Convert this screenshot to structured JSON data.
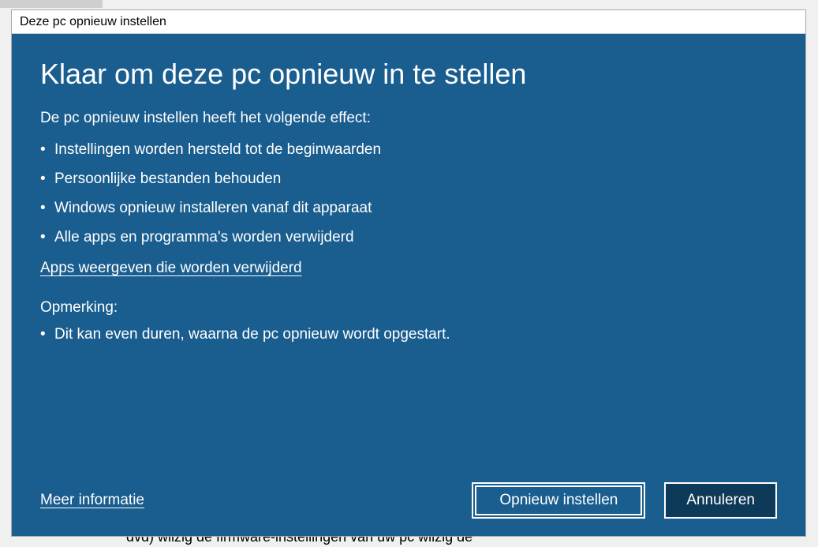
{
  "window": {
    "title": "Deze pc opnieuw instellen"
  },
  "main": {
    "heading": "Klaar om deze pc opnieuw in te stellen",
    "intro": "De pc opnieuw instellen heeft het volgende effect:",
    "effects": [
      "Instellingen worden hersteld tot de beginwaarden",
      "Persoonlijke bestanden behouden",
      "Windows opnieuw installeren vanaf dit apparaat",
      "Alle apps en programma's worden verwijderd"
    ],
    "apps_link": "Apps weergeven die worden verwijderd",
    "note_label": "Opmerking:",
    "notes": [
      "Dit kan even duren, waarna de pc opnieuw wordt opgestart."
    ]
  },
  "footer": {
    "more_info": "Meer informatie",
    "reset": "Opnieuw instellen",
    "cancel": "Annuleren"
  },
  "background": {
    "partial_text": "dvd)  wiizig de firmware-instellingen van uw pc  wiizig de"
  }
}
